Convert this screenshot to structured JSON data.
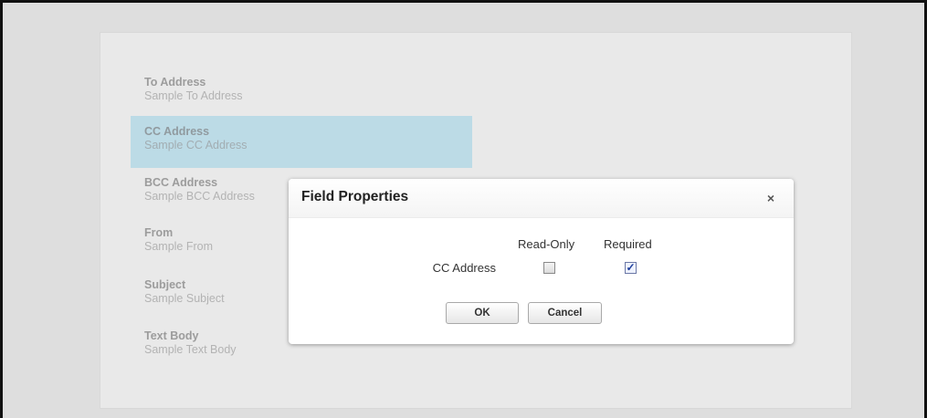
{
  "form": {
    "fields": [
      {
        "label": "To Address",
        "sample": "Sample To Address"
      },
      {
        "label": "CC Address",
        "sample": "Sample CC Address"
      },
      {
        "label": "BCC Address",
        "sample": "Sample BCC Address"
      },
      {
        "label": "From",
        "sample": "Sample From"
      },
      {
        "label": "Subject",
        "sample": "Sample Subject"
      },
      {
        "label": "Text Body",
        "sample": "Sample Text Body"
      }
    ],
    "selected_field": "CC Address"
  },
  "dialog": {
    "title": "Field Properties",
    "close_glyph": "×",
    "columns": {
      "read_only": "Read-Only",
      "required": "Required"
    },
    "row_label": "CC Address",
    "read_only_checked": false,
    "required_checked": true,
    "checkmark": "✓",
    "ok_label": "OK",
    "cancel_label": "Cancel"
  },
  "colors": {
    "selected_row": "#bcdbe6",
    "dialog_bg": "#ffffff",
    "background": "#dedede"
  },
  "icons": {
    "close": "close-icon",
    "check": "checkmark-icon"
  }
}
